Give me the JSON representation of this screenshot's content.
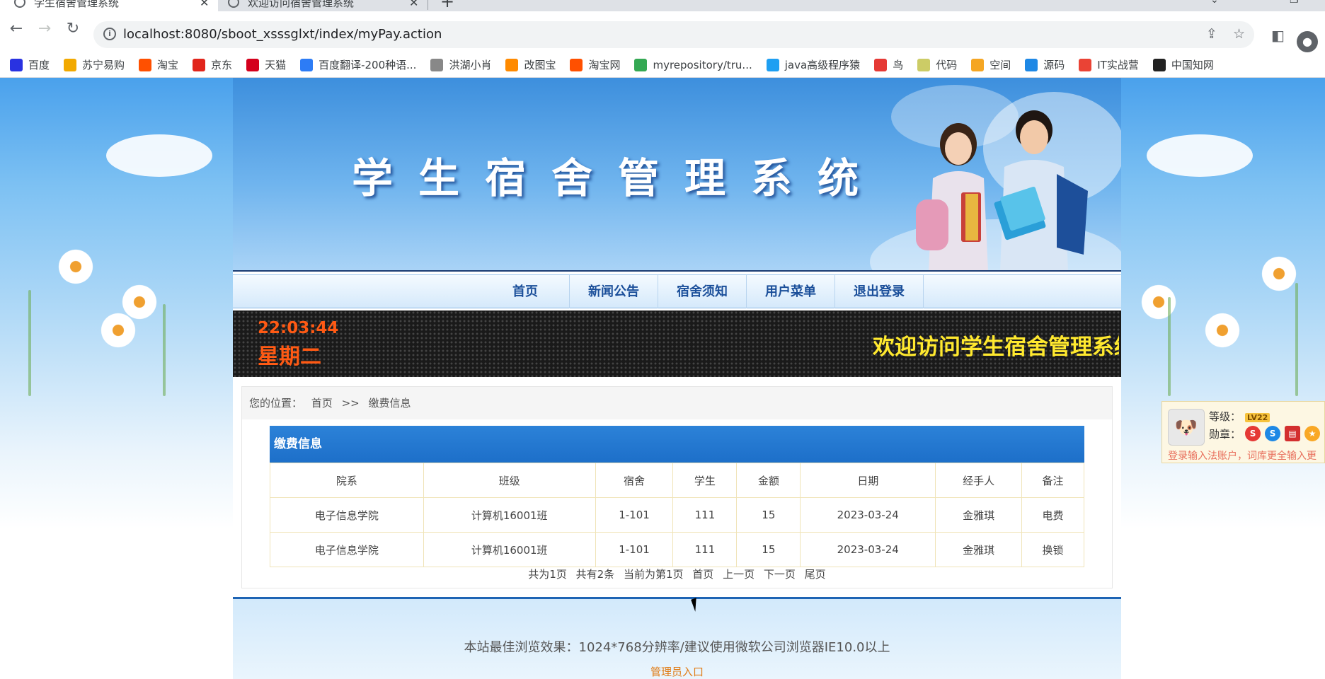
{
  "browser": {
    "tabs": [
      {
        "title": "学生宿舍管理系统",
        "active": true
      },
      {
        "title": "欢迎访问宿舍管理系统",
        "active": false
      }
    ],
    "new_tab": "+",
    "url": "localhost:8080/sboot_xsssglxt/index/myPay.action",
    "bookmarks": [
      {
        "label": "百度",
        "icon": "paw-icon",
        "color": "#2932e1"
      },
      {
        "label": "苏宁易购",
        "icon": "lion-icon",
        "color": "#f2a900"
      },
      {
        "label": "淘宝",
        "icon": "taobao-icon",
        "color": "#ff5000"
      },
      {
        "label": "京东",
        "icon": "jd-icon",
        "color": "#e1251b"
      },
      {
        "label": "天猫",
        "icon": "tmall-icon",
        "color": "#d4001c"
      },
      {
        "label": "百度翻译-200种语...",
        "icon": "translate-icon",
        "color": "#2d7cf5"
      },
      {
        "label": "洪湖小肖",
        "icon": "bird-icon",
        "color": "#888888"
      },
      {
        "label": "改图宝",
        "icon": "image-icon",
        "color": "#ff8a00"
      },
      {
        "label": "淘宝网",
        "icon": "taobao-icon",
        "color": "#ff5000"
      },
      {
        "label": "myrepository/tru...",
        "icon": "chrome-icon",
        "color": "#34a853"
      },
      {
        "label": "java高级程序猿",
        "icon": "tv-icon",
        "color": "#1e9ff2"
      },
      {
        "label": "鸟",
        "icon": "swallow-icon",
        "color": "#e53935"
      },
      {
        "label": "代码",
        "icon": "moon-icon",
        "color": "#cccc66"
      },
      {
        "label": "空间",
        "icon": "star-icon",
        "color": "#f5a623"
      },
      {
        "label": "源码",
        "icon": "fish-icon",
        "color": "#1e88e5"
      },
      {
        "label": "IT实战营",
        "icon": "chrome-icon",
        "color": "#ea4335"
      },
      {
        "label": "中国知网",
        "icon": "cnki-icon",
        "color": "#222222"
      }
    ]
  },
  "site": {
    "banner_title": "学生宿舍管理系统",
    "nav": [
      "首页",
      "新闻公告",
      "宿舍须知",
      "用户菜单",
      "退出登录"
    ],
    "clock": "22:03:44",
    "weekday": "星期二",
    "marquee": "欢迎访问学生宿舍管理系统"
  },
  "breadcrumb": {
    "prefix": "您的位置：",
    "home": "首页",
    "sep": ">>",
    "current": "缴费信息"
  },
  "table": {
    "title": "缴费信息",
    "columns": [
      "院系",
      "班级",
      "宿舍",
      "学生",
      "金额",
      "日期",
      "经手人",
      "备注"
    ],
    "rows": [
      [
        "电子信息学院",
        "计算机16001班",
        "1-101",
        "111",
        "15",
        "2023-03-24",
        "金雅琪",
        "电费"
      ],
      [
        "电子信息学院",
        "计算机16001班",
        "1-101",
        "111",
        "15",
        "2023-03-24",
        "金雅琪",
        "换锁"
      ]
    ]
  },
  "pager": {
    "total_pages": "共为1页",
    "total_items": "共有2条",
    "current": "当前为第1页",
    "first": "首页",
    "prev": "上一页",
    "next": "下一页",
    "last": "尾页"
  },
  "footer": {
    "note": "本站最佳浏览效果：1024*768分辨率/建议使用微软公司浏览器IE10.0以上",
    "admin_link": "管理员入口"
  },
  "ime_panel": {
    "level_label": "等级：",
    "level_badge": "LV22",
    "medal_label": "勋章：",
    "tip": "登录输入法账户，词库更全输入更"
  }
}
